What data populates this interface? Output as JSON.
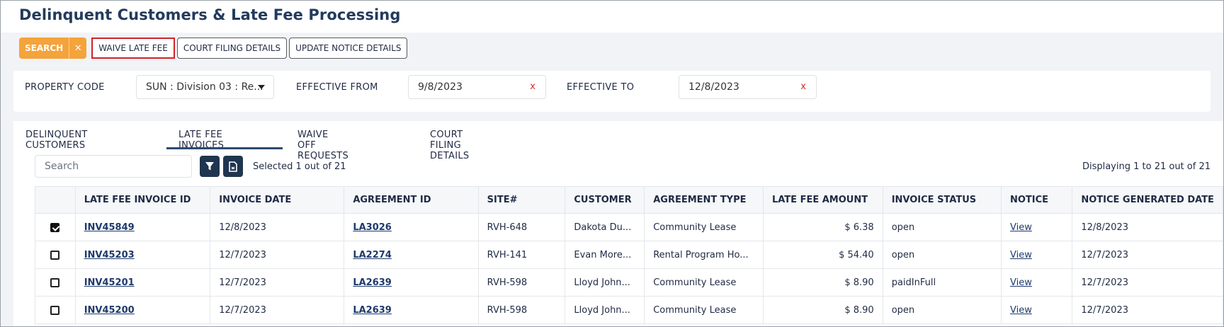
{
  "page": {
    "title": "Delinquent Customers & Late Fee Processing"
  },
  "toolbar": {
    "search_label": "SEARCH",
    "clear_label": "✕",
    "waive_label": "WAIVE LATE FEE",
    "court_label": "COURT FILING DETAILS",
    "notice_label": "UPDATE NOTICE DETAILS"
  },
  "filters": {
    "property_label": "PROPERTY CODE",
    "property_value": "SUN : Division 03 : Re...",
    "from_label": "EFFECTIVE FROM",
    "from_value": "9/8/2023",
    "to_label": "EFFECTIVE TO",
    "to_value": "12/8/2023",
    "clear_glyph": "x"
  },
  "tabs": [
    {
      "label": "DELINQUENT CUSTOMERS"
    },
    {
      "label": "LATE FEE INVOICES",
      "active": true
    },
    {
      "label": "WAIVE OFF REQUESTS"
    },
    {
      "label": "COURT FILING DETAILS"
    }
  ],
  "grid": {
    "search_placeholder": "Search",
    "selected_text": "Selected 1 out of 21",
    "display_text": "Displaying 1 to 21 out of 21",
    "columns": [
      "LATE FEE INVOICE ID",
      "INVOICE DATE",
      "AGREEMENT ID",
      "SITE#",
      "CUSTOMER",
      "AGREEMENT TYPE",
      "LATE FEE AMOUNT",
      "INVOICE STATUS",
      "NOTICE",
      "NOTICE GENERATED DATE"
    ],
    "rows": [
      {
        "checked": true,
        "invoice_id": "INV45849",
        "invoice_date": "12/8/2023",
        "agreement_id": "LA3026",
        "site": "RVH-648",
        "customer": "Dakota Du...",
        "agreement_type": "Community Lease",
        "amount": "$ 6.38",
        "status": "open",
        "notice": "View",
        "notice_date": "12/8/2023"
      },
      {
        "checked": false,
        "invoice_id": "INV45203",
        "invoice_date": "12/7/2023",
        "agreement_id": "LA2274",
        "site": "RVH-141",
        "customer": "Evan More...",
        "agreement_type": "Rental Program Ho...",
        "amount": "$ 54.40",
        "status": "open",
        "notice": "View",
        "notice_date": "12/7/2023"
      },
      {
        "checked": false,
        "invoice_id": "INV45201",
        "invoice_date": "12/7/2023",
        "agreement_id": "LA2639",
        "site": "RVH-598",
        "customer": "Lloyd John...",
        "agreement_type": "Community Lease",
        "amount": "$ 8.90",
        "status": "paidInFull",
        "notice": "View",
        "notice_date": "12/7/2023"
      },
      {
        "checked": false,
        "invoice_id": "INV45200",
        "invoice_date": "12/7/2023",
        "agreement_id": "LA2639",
        "site": "RVH-598",
        "customer": "Lloyd John...",
        "agreement_type": "Community Lease",
        "amount": "$ 8.90",
        "status": "open",
        "notice": "View",
        "notice_date": "12/7/2023"
      }
    ]
  },
  "colors": {
    "accent": "#f5a33b",
    "title": "#233a5c",
    "link": "#1e3a6c",
    "highlight": "#d0222b",
    "icon_button": "#1f3550"
  },
  "icons": {
    "filter": "filter-icon",
    "export": "export-file-icon",
    "dropdown": "chevron-down-icon"
  }
}
